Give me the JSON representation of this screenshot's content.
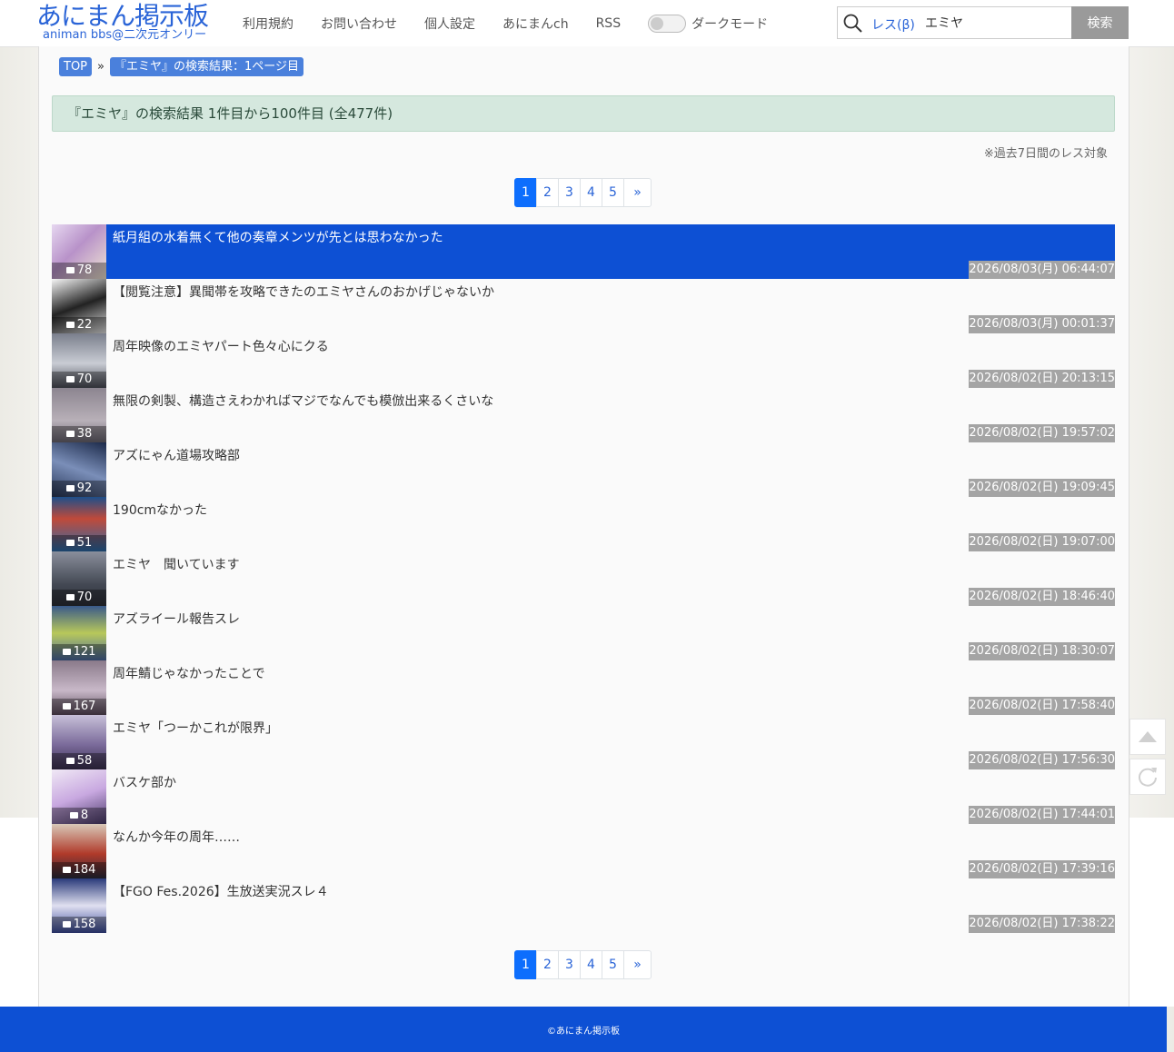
{
  "header": {
    "logo_title": "あにまん掲示板",
    "logo_sub": "animan bbs@二次元オンリー",
    "nav": [
      "利用規約",
      "お問い合わせ",
      "個人設定",
      "あにまんch",
      "RSS"
    ],
    "dark_mode_label": "ダークモード",
    "search": {
      "mode": "レス(β)",
      "value": "エミヤ",
      "button": "検索"
    }
  },
  "breadcrumb": {
    "top": "TOP",
    "sep": "»",
    "current": "『エミヤ』の検索結果：1ページ目"
  },
  "result_summary": "『エミヤ』の検索結果 1件目から100件目 (全477件)",
  "note": "※過去7日間のレス対象",
  "pagination": {
    "pages": [
      "1",
      "2",
      "3",
      "4",
      "5"
    ],
    "next": "»",
    "current": "1"
  },
  "threads": [
    {
      "title": "紙月組の水着無くて他の奏章メンツが先とは思わなかった",
      "count": "78",
      "date": "2026/08/03(月) 06:44:07",
      "active": true
    },
    {
      "title": "【閲覧注意】異聞帯を攻略できたのエミヤさんのおかげじゃないか",
      "count": "22",
      "date": "2026/08/03(月) 00:01:37"
    },
    {
      "title": "周年映像のエミヤパート色々心にクる",
      "count": "70",
      "date": "2026/08/02(日) 20:13:15"
    },
    {
      "title": "無限の剣製、構造さえわかればマジでなんでも模倣出来るくさいな",
      "count": "38",
      "date": "2026/08/02(日) 19:57:02"
    },
    {
      "title": "アズにゃん道場攻略部",
      "count": "92",
      "date": "2026/08/02(日) 19:09:45"
    },
    {
      "title": "190cmなかった",
      "count": "51",
      "date": "2026/08/02(日) 19:07:00"
    },
    {
      "title": "エミヤ　聞いています",
      "count": "70",
      "date": "2026/08/02(日) 18:46:40"
    },
    {
      "title": "アズライール報告スレ",
      "count": "121",
      "date": "2026/08/02(日) 18:30:07"
    },
    {
      "title": "周年鯖じゃなかったことで",
      "count": "167",
      "date": "2026/08/02(日) 17:58:40"
    },
    {
      "title": "エミヤ「つーかこれが限界」",
      "count": "58",
      "date": "2026/08/02(日) 17:56:30"
    },
    {
      "title": "バスケ部か",
      "count": "8",
      "date": "2026/08/02(日) 17:44:01"
    },
    {
      "title": "なんか今年の周年……",
      "count": "184",
      "date": "2026/08/02(日) 17:39:16"
    },
    {
      "title": "【FGO Fes.2026】生放送実況スレ４",
      "count": "158",
      "date": "2026/08/02(日) 17:38:22"
    }
  ],
  "footer": "©あにまん掲示板",
  "colors": {
    "brand": "#2a64d7",
    "active_row": "#0d50d4",
    "footer": "#0d50d4",
    "result_box": "#d5e8de",
    "date_badge": "#a4a4a4"
  },
  "icons": {
    "search": "search-icon",
    "comment": "comment-icon",
    "scroll_top": "arrow-up-icon",
    "reload": "reload-icon"
  }
}
